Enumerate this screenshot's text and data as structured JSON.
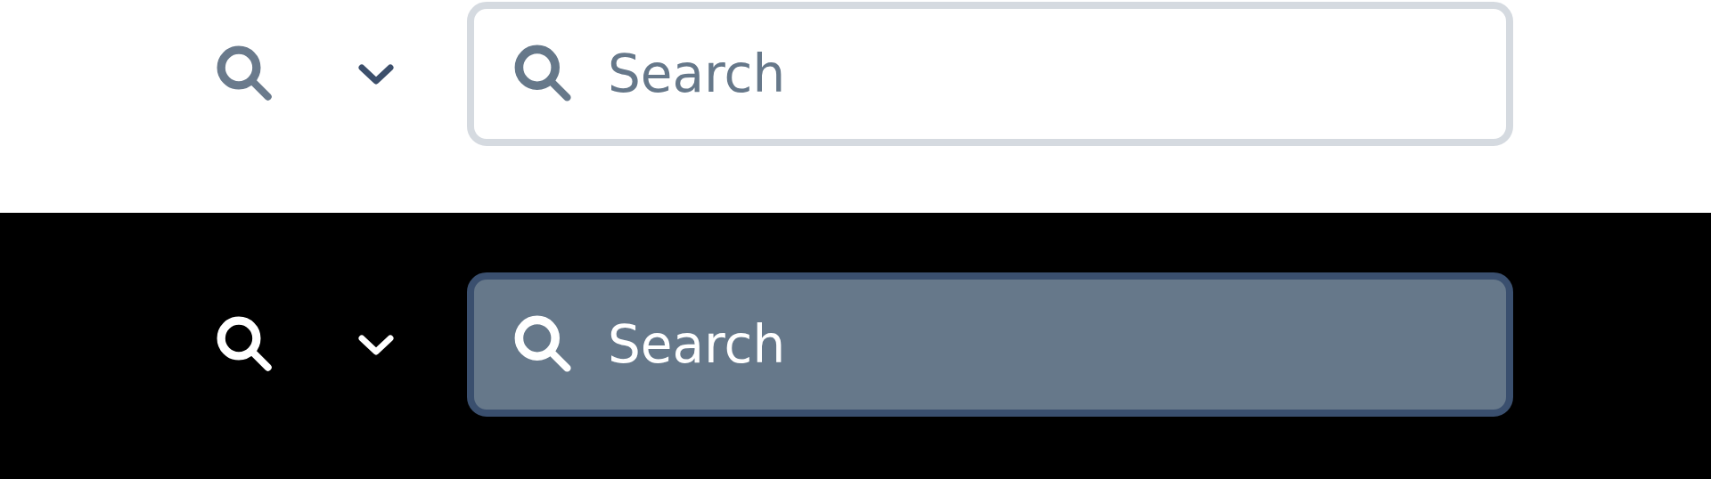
{
  "variants": [
    {
      "kind": "light",
      "search": {
        "placeholder": "Search"
      }
    },
    {
      "kind": "dark",
      "search": {
        "placeholder": "Search"
      }
    }
  ]
}
